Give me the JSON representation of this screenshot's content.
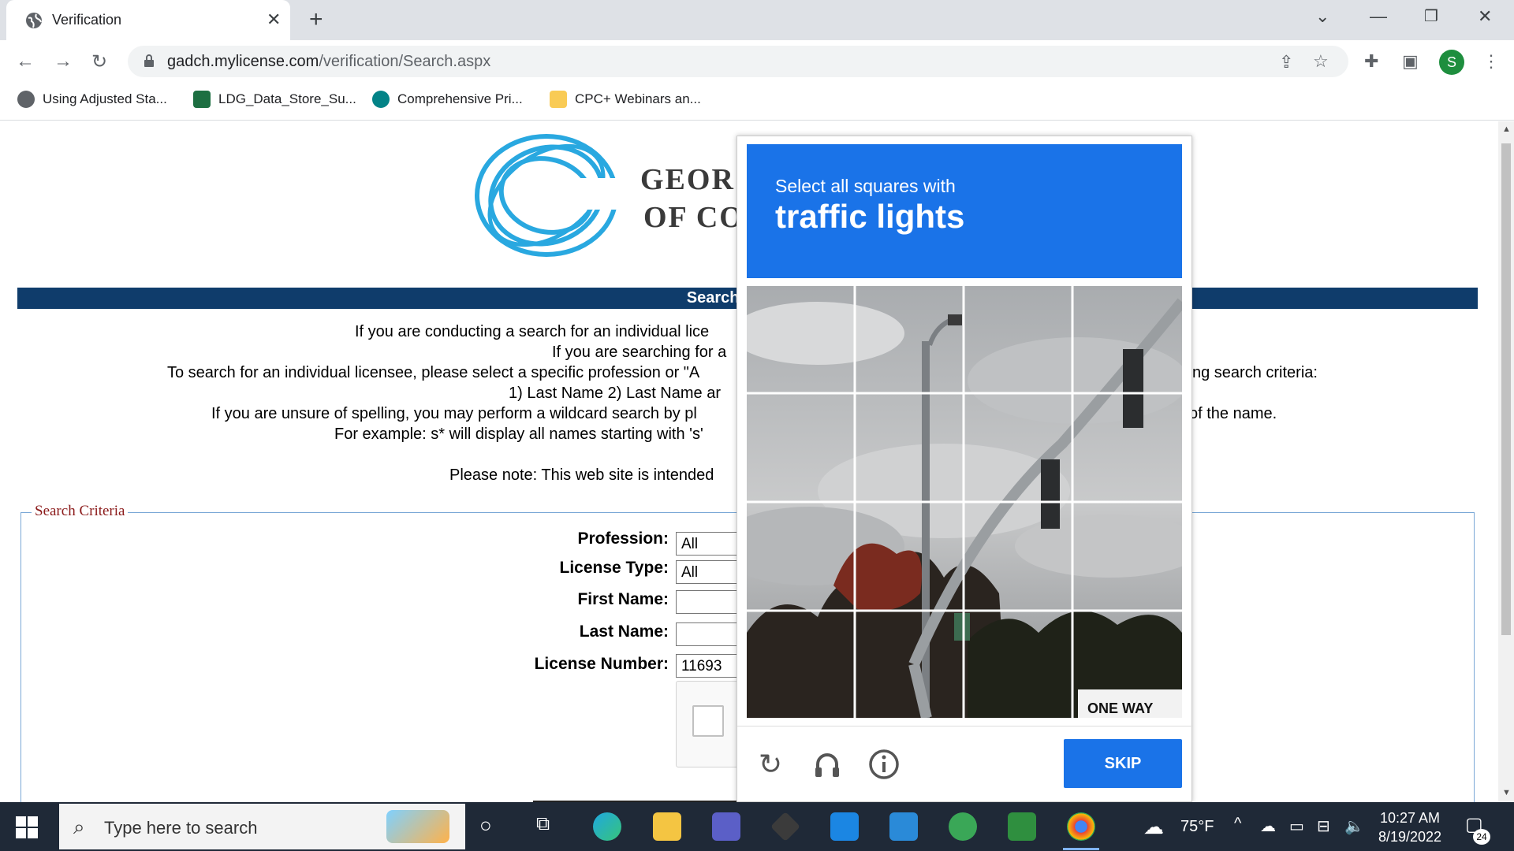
{
  "browser": {
    "tab_title": "Verification",
    "new_tab": "+",
    "url_domain": "gadch.mylicense.com",
    "url_path": "/verification/Search.aspx",
    "bookmarks": [
      "Using Adjusted Sta...",
      "LDG_Data_Store_Su...",
      "Comprehensive Pri...",
      "CPC+ Webinars an..."
    ],
    "profile_initial": "S"
  },
  "page": {
    "logo_text_1": "GEOR",
    "logo_text_2": "OF CO",
    "banner_title": "Search for a Pro",
    "instructions": {
      "line1": "If you are conducting a search for an individual lice",
      "line2": "If you are searching for a",
      "line3_left": "To search for an individual licensee, please select a specific profession or \"A",
      "line3_right": "ng search criteria:",
      "line4": "1) Last Name 2) Last Name ar",
      "line5_left": "If you are unsure of spelling, you may perform a wildcard search by pl",
      "line5_right": "of the name.",
      "line6": "For example: s* will display all names starting with 's'",
      "line7": "Please note: This web site is intended"
    },
    "search_criteria": {
      "legend": "Search Criteria",
      "profession_label": "Profession:",
      "profession_value": "All",
      "license_type_label": "License Type:",
      "license_type_value": "All",
      "first_name_label": "First Name:",
      "first_name_value": "",
      "last_name_label": "Last Name:",
      "last_name_value": "",
      "license_number_label": "License Number:",
      "license_number_value": "11693"
    }
  },
  "captcha": {
    "instruction_line1": "Select all squares with",
    "instruction_target": "traffic lights",
    "skip_label": "SKIP",
    "street_sign": "ONE WAY",
    "icons": [
      "reload-icon",
      "audio-icon",
      "info-icon"
    ]
  },
  "taskbar": {
    "search_placeholder": "Type here to search",
    "temperature": "75°F",
    "time": "10:27 AM",
    "date": "8/19/2022",
    "notifications": "24"
  }
}
